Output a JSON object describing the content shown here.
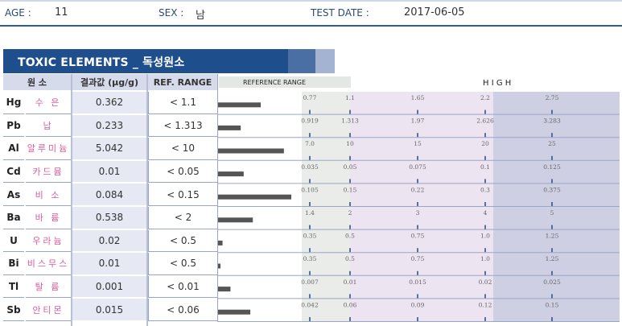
{
  "patient": {
    "age_label": "AGE :",
    "age_value": "11",
    "sex_label": "SEX :",
    "sex_value": "남",
    "test_date_label": "TEST DATE :",
    "test_date_value": "2017-06-05"
  },
  "section_title": "TOXIC ELEMENTS _ 독성원소",
  "table_headers": {
    "element": "원  소",
    "result": "결과값 (µg/g)",
    "ref_range": "REF. RANGE",
    "reference_range": "REFERENCE   RANGE",
    "high": "H I G H"
  },
  "colors": {
    "banner": "#1f4e8c",
    "reference_zone": "#e9ece9",
    "high_zone_light": "#ece4f1",
    "high_zone_dark": "#cfcfe4",
    "bar": "#555555",
    "korean_name": "#d85c9c"
  },
  "chart_data": {
    "type": "bar",
    "orientation": "horizontal",
    "rows": [
      {
        "symbol": "Hg",
        "name": "수 은",
        "result": "0.362",
        "ref": "< 1.1",
        "value": 0.362,
        "ticks": [
          "0.77",
          "1.1",
          "1.65",
          "2.2",
          "2.75"
        ],
        "tick_values": [
          0.77,
          1.1,
          1.65,
          2.2,
          2.75
        ]
      },
      {
        "symbol": "Pb",
        "name": "납",
        "result": "0.233",
        "ref": "< 1.313",
        "value": 0.233,
        "ticks": [
          "0.919",
          "1.313",
          "1.97",
          "2.626",
          "3.283"
        ],
        "tick_values": [
          0.919,
          1.313,
          1.97,
          2.626,
          3.283
        ]
      },
      {
        "symbol": "Al",
        "name": "알루미늄",
        "result": "5.042",
        "ref": "< 10",
        "value": 5.042,
        "ticks": [
          "7.0",
          "10",
          "15",
          "20",
          "25"
        ],
        "tick_values": [
          7.0,
          10,
          15,
          20,
          25
        ]
      },
      {
        "symbol": "Cd",
        "name": "카드뮴",
        "result": "0.01",
        "ref": "< 0.05",
        "value": 0.01,
        "ticks": [
          "0.035",
          "0.05",
          "0.075",
          "0.1",
          "0.125"
        ],
        "tick_values": [
          0.035,
          0.05,
          0.075,
          0.1,
          0.125
        ]
      },
      {
        "symbol": "As",
        "name": "비 소",
        "result": "0.084",
        "ref": "< 0.15",
        "value": 0.084,
        "ticks": [
          "0.105",
          "0.15",
          "0.22",
          "0.3",
          "0.375"
        ],
        "tick_values": [
          0.105,
          0.15,
          0.22,
          0.3,
          0.375
        ]
      },
      {
        "symbol": "Ba",
        "name": "바 륨",
        "result": "0.538",
        "ref": "< 2",
        "value": 0.538,
        "ticks": [
          "1.4",
          "2",
          "3",
          "4",
          "5"
        ],
        "tick_values": [
          1.4,
          2,
          3,
          4,
          5
        ]
      },
      {
        "symbol": "U",
        "name": "우라늄",
        "result": "0.02",
        "ref": "< 0.5",
        "value": 0.02,
        "ticks": [
          "0.35",
          "0.5",
          "0.75",
          "1.0",
          "1.25"
        ],
        "tick_values": [
          0.35,
          0.5,
          0.75,
          1.0,
          1.25
        ]
      },
      {
        "symbol": "Bi",
        "name": "비스무스",
        "result": "0.01",
        "ref": "< 0.5",
        "value": 0.01,
        "ticks": [
          "0.35",
          "0.5",
          "0.75",
          "1.0",
          "1.25"
        ],
        "tick_values": [
          0.35,
          0.5,
          0.75,
          1.0,
          1.25
        ]
      },
      {
        "symbol": "Tl",
        "name": "탈 륨",
        "result": "0.001",
        "ref": "< 0.01",
        "value": 0.001,
        "ticks": [
          "0.007",
          "0.01",
          "0.015",
          "0.02",
          "0.025"
        ],
        "tick_values": [
          0.007,
          0.01,
          0.015,
          0.02,
          0.025
        ]
      },
      {
        "symbol": "Sb",
        "name": "안티몬",
        "result": "0.015",
        "ref": "< 0.06",
        "value": 0.015,
        "ticks": [
          "0.042",
          "0.06",
          "0.09",
          "0.12",
          "0.15"
        ],
        "tick_values": [
          0.042,
          0.06,
          0.09,
          0.12,
          0.15
        ]
      }
    ]
  }
}
